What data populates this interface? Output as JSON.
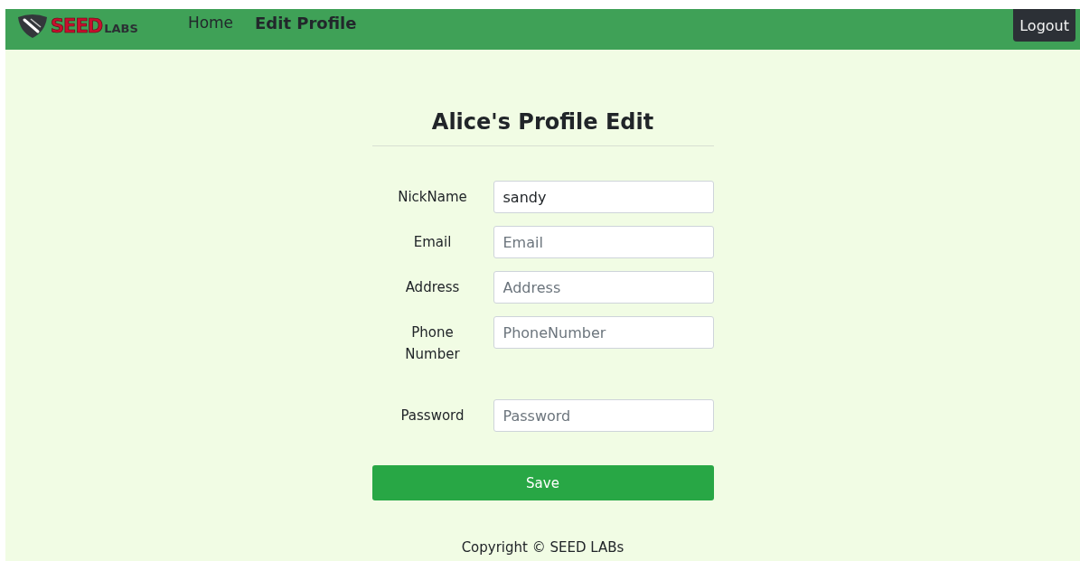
{
  "navbar": {
    "logo": {
      "brand": "SEED",
      "suffix": "LABS"
    },
    "links": [
      {
        "label": "Home",
        "selected": false
      },
      {
        "label": "Edit Profile",
        "selected": true
      }
    ],
    "logout": "Logout"
  },
  "form": {
    "title": "Alice's Profile Edit",
    "fields": [
      {
        "label": "NickName",
        "value": "sandy"
      },
      {
        "label": "Email",
        "placeholder": "Email"
      },
      {
        "label": "Address",
        "placeholder": "Address"
      },
      {
        "label": "Phone Number",
        "placeholder": "PhoneNumber"
      },
      {
        "label": "Password",
        "placeholder": "Password"
      }
    ],
    "submit": "Save"
  },
  "footer": "Copyright © SEED LABs"
}
